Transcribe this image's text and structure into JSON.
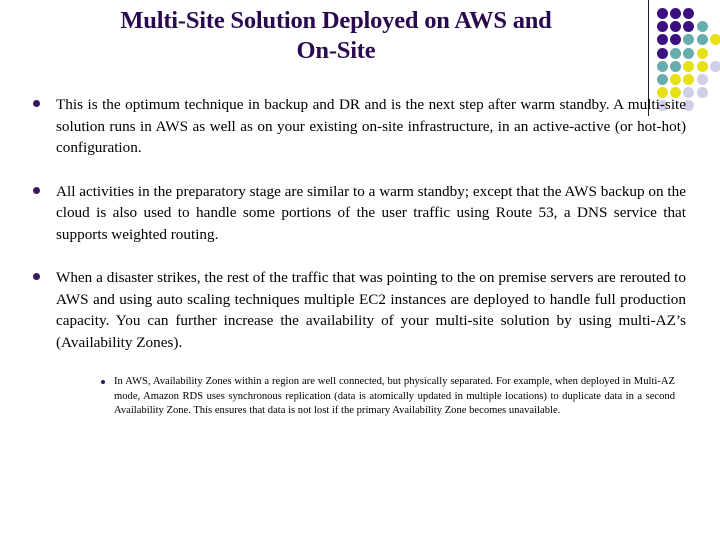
{
  "slide": {
    "title": "Multi-Site Solution Deployed on AWS and On-Site",
    "title_line1": "Multi-Site Solution Deployed on AWS and",
    "title_line2": "On-Site",
    "title_color": "#2A0A4F",
    "background_color": "#FFFFFF",
    "text_color": "#000000",
    "bullet_marker_color": "#3B1561"
  },
  "bullets": [
    {
      "marker": "bullet-dot",
      "text": "This is the optimum technique in backup and DR and is the next step after warm standby. A multi-site solution runs in AWS as well as on your existing on-site infrastructure, in an active-active (or hot-hot) configuration."
    },
    {
      "marker": "bullet-dot",
      "text": "All activities in the preparatory stage are similar to a warm standby; except that the AWS backup on the cloud is also used to handle some portions of the user traffic using Route 53, a DNS service that supports weighted routing."
    },
    {
      "marker": "bullet-dot",
      "text": "When a disaster strikes, the rest of the traffic that was pointing to the on premise servers are rerouted to AWS and using auto scaling techniques multiple EC2 instances are deployed to handle full production capacity. You can further increase the availability of your multi-site solution by using multi-AZ’s (Availability Zones)."
    }
  ],
  "sub_bullets": [
    {
      "marker": "bullet-dot",
      "text": "In AWS, Availability Zones within a region are well connected, but physically separated. For example, when deployed in Multi-AZ mode, Amazon RDS uses synchronous replication (data is atomically updated in multiple locations) to duplicate data in a second Availability Zone. This ensures that data is not lost if the primary Availability Zone becomes unavailable."
    }
  ],
  "decoration": {
    "name": "dot-grid-decoration",
    "palette": {
      "purple": "#3B1080",
      "teal": "#67ADAD",
      "yellow": "#E8E017",
      "lavender": "#CFCFE8"
    },
    "divider_color": "#1A1A2E",
    "grid": [
      [
        "purple",
        "purple",
        "purple",
        null,
        null
      ],
      [
        "purple",
        "purple",
        "purple",
        "teal",
        null
      ],
      [
        "purple",
        "purple",
        "teal",
        "teal",
        "yellow"
      ],
      [
        "purple",
        "teal",
        "teal",
        "yellow",
        null
      ],
      [
        "teal",
        "teal",
        "yellow",
        "yellow",
        "lavender"
      ],
      [
        "teal",
        "yellow",
        "yellow",
        "lavender",
        null
      ],
      [
        "yellow",
        "yellow",
        "lavender",
        "lavender",
        null
      ],
      [
        "lavender",
        null,
        "lavender",
        null,
        null
      ]
    ]
  }
}
